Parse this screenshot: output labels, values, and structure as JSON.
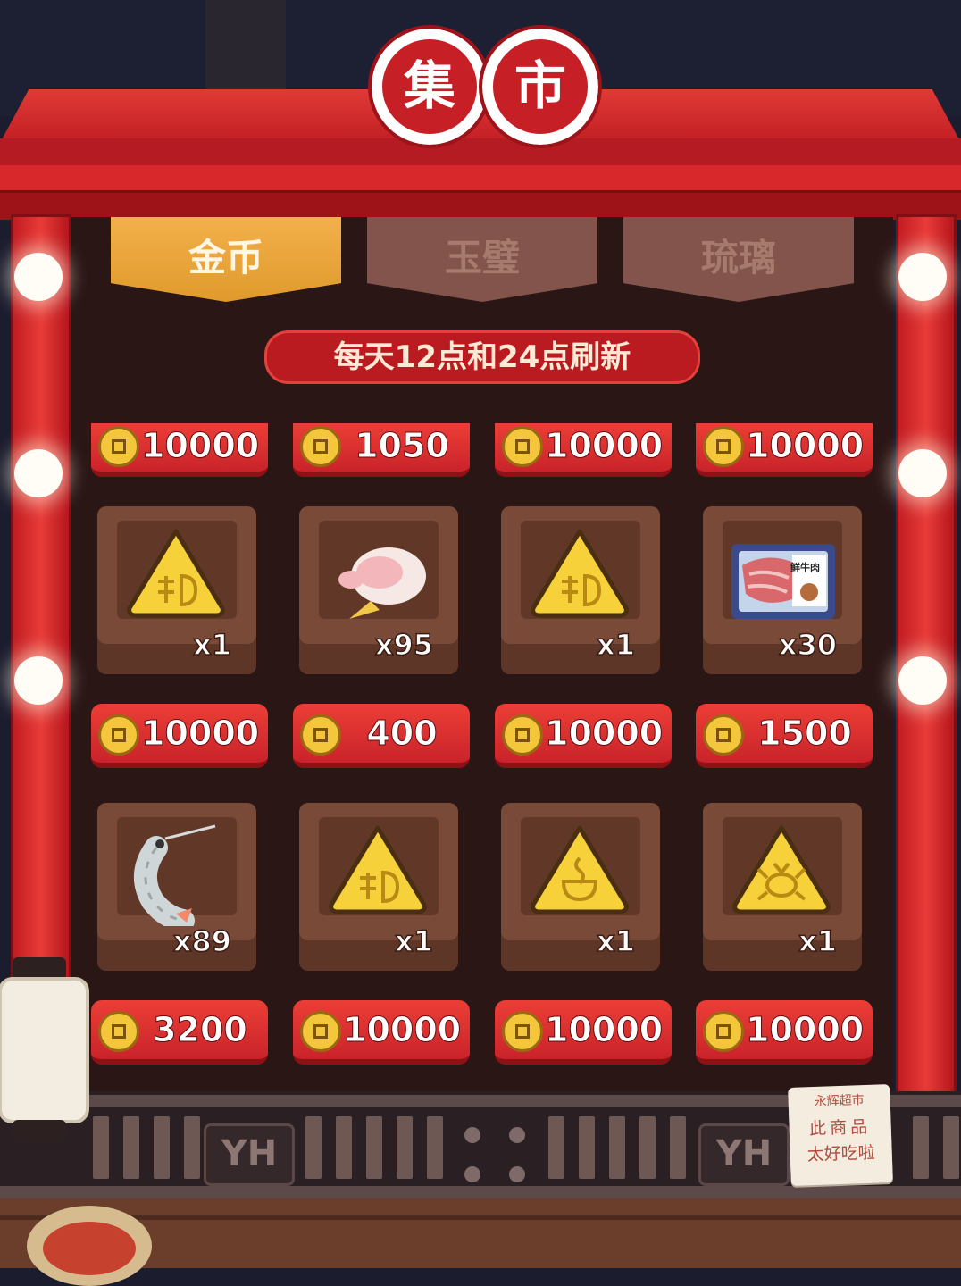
{
  "title": {
    "char1": "集",
    "char2": "市"
  },
  "tabs": [
    {
      "label": "金币",
      "active": true
    },
    {
      "label": "玉璧",
      "active": false
    },
    {
      "label": "琉璃",
      "active": false
    }
  ],
  "refresh_notice": "每天12点和24点刷新",
  "price_rows": [
    [
      "10000",
      "1050",
      "10000",
      "10000"
    ],
    [
      "10000",
      "400",
      "10000",
      "1500"
    ],
    [
      "3200",
      "10000",
      "10000",
      "10000"
    ]
  ],
  "item_rows": [
    [
      {
        "icon": "golden-triangle-glyph-icon",
        "qty": "x1"
      },
      {
        "icon": "duck-icon",
        "qty": "x95"
      },
      {
        "icon": "golden-triangle-glyph-icon",
        "qty": "x1"
      },
      {
        "icon": "beef-package-icon",
        "qty": "x30",
        "package_label": "鲜牛肉"
      }
    ],
    [
      {
        "icon": "shrimp-icon",
        "qty": "x89"
      },
      {
        "icon": "golden-triangle-glyph-icon",
        "qty": "x1"
      },
      {
        "icon": "golden-triangle-soup-icon",
        "qty": "x1"
      },
      {
        "icon": "golden-triangle-crab-icon",
        "qty": "x1"
      }
    ]
  ],
  "fence_signs": [
    "YH",
    "YH"
  ],
  "note": {
    "line1": "永辉超市",
    "line2": "此商品",
    "line3": "太好吃啦"
  },
  "colors": {
    "accent_red": "#d8282c",
    "tab_active": "#e09a2c",
    "tab_inactive": "#83544b",
    "board": "#2b1616",
    "coin": "#f3c63c"
  }
}
